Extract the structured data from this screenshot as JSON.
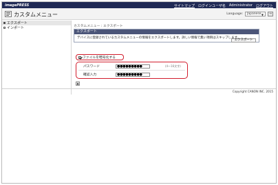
{
  "app": {
    "brand": "imagePRESS",
    "top_links": {
      "sitemap": "サイトマップ",
      "login_user_label": "ログインユーザ名",
      "login_user": "Administrator",
      "logout": "ログアウト"
    }
  },
  "header": {
    "title": "カスタムメニュー",
    "language_label": "Language:",
    "language_value": "Japanese",
    "go_label": "→"
  },
  "sidebar": {
    "items": [
      {
        "label": "エクスポート",
        "active": true
      },
      {
        "label": "インポート",
        "active": false
      }
    ]
  },
  "main": {
    "breadcrumb": "カスタムメニュー : エクスポート",
    "section_title": "エクスポート",
    "description": "デバイスに登録されているカスタムメニューの情報をエクスポートします。詳しい情報で無い項目はスキップします。",
    "export_button": "エクスポート",
    "encrypt_label": "ファイルを暗号化する",
    "encrypt_checked": true,
    "password_label": "パスワード",
    "password_value": "●●●●●●●●●",
    "password_hint": "(4〜16文字)",
    "confirm_label": "確認入力",
    "confirm_value": "●●●●●●●●●",
    "small_button": "▲"
  },
  "footer": {
    "copyright": "Copyright CANON INC. 2015"
  }
}
